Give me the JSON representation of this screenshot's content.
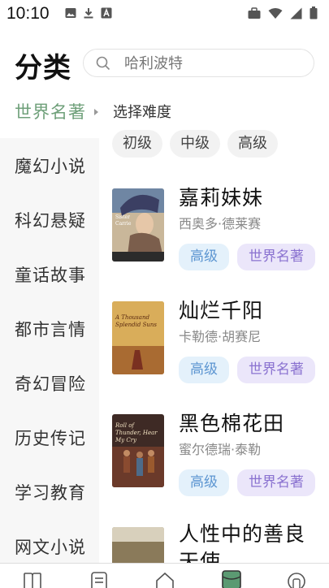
{
  "status_bar": {
    "time": "10:10",
    "left_icons": [
      "image-icon",
      "download-icon",
      "a-box-icon"
    ],
    "right_icons": [
      "briefcase-icon",
      "wifi-icon",
      "signal-icon",
      "battery-icon"
    ]
  },
  "header": {
    "title": "分类",
    "search_placeholder": "哈利波特"
  },
  "sidebar": {
    "items": [
      {
        "label": "世界名著",
        "active": true
      },
      {
        "label": "魔幻小说",
        "active": false
      },
      {
        "label": "科幻悬疑",
        "active": false
      },
      {
        "label": "童话故事",
        "active": false
      },
      {
        "label": "都市言情",
        "active": false
      },
      {
        "label": "奇幻冒险",
        "active": false
      },
      {
        "label": "历史传记",
        "active": false
      },
      {
        "label": "学习教育",
        "active": false
      },
      {
        "label": "网文小说",
        "active": false
      }
    ]
  },
  "difficulty": {
    "title": "选择难度",
    "options": [
      "初级",
      "中级",
      "高级"
    ]
  },
  "books": [
    {
      "title": "嘉莉妹妹",
      "author": "西奥多·德莱赛",
      "level": "高级",
      "category": "世界名著",
      "cover_text": "Sister Carrie"
    },
    {
      "title": "灿烂千阳",
      "author": "卡勒德·胡赛尼",
      "level": "高级",
      "category": "世界名著",
      "cover_text": "A Thousand Splendid Suns"
    },
    {
      "title": "黑色棉花田",
      "author": "蜜尔德瑞·泰勒",
      "level": "高级",
      "category": "世界名著",
      "cover_text": "Roll of Thunder, Hear My Cry"
    },
    {
      "title": "人性中的善良天使",
      "author": "",
      "level": "",
      "category": "",
      "cover_text": ""
    }
  ],
  "bottom_nav": {
    "icons": [
      "book-icon",
      "document-icon",
      "home-icon",
      "category-icon",
      "profile-icon"
    ]
  },
  "colors": {
    "active_sidebar": "#6fa07a",
    "level_tag_bg": "#e4f1fb",
    "level_tag_text": "#5c95d1",
    "category_tag_bg": "#ebe6fa",
    "category_tag_text": "#8a72d0"
  }
}
